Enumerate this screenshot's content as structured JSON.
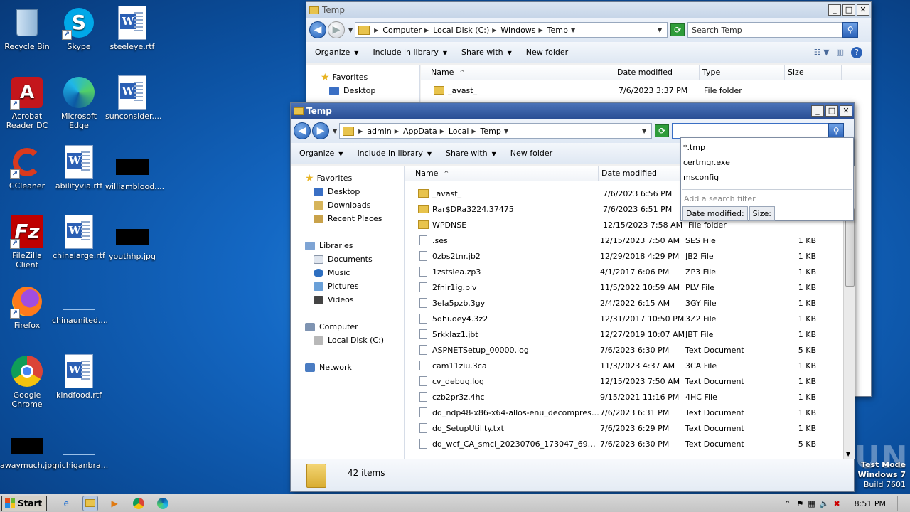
{
  "desktop": {
    "icons": [
      {
        "label": "Recycle Bin",
        "icon": "recycle-bin-icon"
      },
      {
        "label": "Skype",
        "icon": "skype-icon"
      },
      {
        "label": "steeleye.rtf",
        "icon": "word-doc-icon"
      },
      {
        "label": "Acrobat Reader DC",
        "icon": "acrobat-icon"
      },
      {
        "label": "Microsoft Edge",
        "icon": "edge-icon"
      },
      {
        "label": "sunconsider....",
        "icon": "word-doc-icon"
      },
      {
        "label": "CCleaner",
        "icon": "ccleaner-icon"
      },
      {
        "label": "abilityvia.rtf",
        "icon": "word-doc-icon"
      },
      {
        "label": "williamblood....",
        "icon": "image-thumb-icon"
      },
      {
        "label": "FileZilla Client",
        "icon": "filezilla-icon"
      },
      {
        "label": "chinalarge.rtf",
        "icon": "word-doc-icon"
      },
      {
        "label": "youthhp.jpg",
        "icon": "image-thumb-icon"
      },
      {
        "label": "Firefox",
        "icon": "firefox-icon"
      },
      {
        "label": "chinaunited....",
        "icon": "blank-file-icon"
      },
      {
        "label": "Google Chrome",
        "icon": "chrome-icon"
      },
      {
        "label": "kindfood.rtf",
        "icon": "word-doc-icon"
      },
      {
        "label": "awaymuch.jpg",
        "icon": "image-thumb-icon"
      },
      {
        "label": "michiganbra...",
        "icon": "blank-file-icon"
      }
    ]
  },
  "back_window": {
    "title": "Temp",
    "breadcrumbs": [
      "Computer",
      "Local Disk (C:)",
      "Windows",
      "Temp"
    ],
    "search_placeholder": "Search Temp",
    "toolbar": {
      "organize": "Organize",
      "include": "Include in library",
      "share": "Share with",
      "new_folder": "New folder"
    },
    "columns": {
      "name": "Name",
      "date": "Date modified",
      "type": "Type",
      "size": "Size"
    },
    "favorites": "Favorites",
    "desktop": "Desktop",
    "row": {
      "name": "_avast_",
      "date": "7/6/2023 3:37 PM",
      "type": "File folder"
    }
  },
  "front_window": {
    "title": "Temp",
    "breadcrumbs": [
      "admin",
      "AppData",
      "Local",
      "Temp"
    ],
    "search_value": "",
    "toolbar": {
      "organize": "Organize",
      "include": "Include in library",
      "share": "Share with",
      "new_folder": "New folder"
    },
    "columns": {
      "name": "Name",
      "date": "Date modified"
    },
    "nav": {
      "favorites": "Favorites",
      "desktop": "Desktop",
      "downloads": "Downloads",
      "recent": "Recent Places",
      "libraries": "Libraries",
      "documents": "Documents",
      "music": "Music",
      "pictures": "Pictures",
      "videos": "Videos",
      "computer": "Computer",
      "local_disk": "Local Disk (C:)",
      "network": "Network"
    },
    "search_suggestions": [
      "*.tmp",
      "certmgr.exe",
      "msconfig"
    ],
    "add_filter": "Add a search filter",
    "filters": [
      "Date modified:",
      "Size:"
    ],
    "files": [
      {
        "name": "_avast_",
        "date": "7/6/2023 6:56 PM",
        "type": "",
        "size": "",
        "kind": "folder"
      },
      {
        "name": "Rar$DRa3224.37475",
        "date": "7/6/2023 6:51 PM",
        "type": "",
        "size": "",
        "kind": "folder"
      },
      {
        "name": "WPDNSE",
        "date": "12/15/2023 7:58 AM",
        "type": "File folder",
        "size": "",
        "kind": "folder"
      },
      {
        "name": ".ses",
        "date": "12/15/2023 7:50 AM",
        "type": "SES File",
        "size": "1 KB",
        "kind": "file"
      },
      {
        "name": "0zbs2tnr.jb2",
        "date": "12/29/2018 4:29 PM",
        "type": "JB2 File",
        "size": "1 KB",
        "kind": "file"
      },
      {
        "name": "1zstsiea.zp3",
        "date": "4/1/2017 6:06 PM",
        "type": "ZP3 File",
        "size": "1 KB",
        "kind": "file"
      },
      {
        "name": "2fnir1ig.plv",
        "date": "11/5/2022 10:59 AM",
        "type": "PLV File",
        "size": "1 KB",
        "kind": "file"
      },
      {
        "name": "3ela5pzb.3gy",
        "date": "2/4/2022 6:15 AM",
        "type": "3GY File",
        "size": "1 KB",
        "kind": "file"
      },
      {
        "name": "5qhuoey4.3z2",
        "date": "12/31/2017 10:50 PM",
        "type": "3Z2 File",
        "size": "1 KB",
        "kind": "file"
      },
      {
        "name": "5rkklaz1.jbt",
        "date": "12/27/2019 10:07 AM",
        "type": "JBT File",
        "size": "1 KB",
        "kind": "file"
      },
      {
        "name": "ASPNETSetup_00000.log",
        "date": "7/6/2023 6:30 PM",
        "type": "Text Document",
        "size": "5 KB",
        "kind": "file"
      },
      {
        "name": "cam11ziu.3ca",
        "date": "11/3/2023 4:37 AM",
        "type": "3CA File",
        "size": "1 KB",
        "kind": "file"
      },
      {
        "name": "cv_debug.log",
        "date": "12/15/2023 7:50 AM",
        "type": "Text Document",
        "size": "1 KB",
        "kind": "file"
      },
      {
        "name": "czb2pr3z.4hc",
        "date": "9/15/2021 11:16 PM",
        "type": "4HC File",
        "size": "1 KB",
        "kind": "file"
      },
      {
        "name": "dd_ndp48-x86-x64-allos-enu_decompression...",
        "date": "7/6/2023 6:31 PM",
        "type": "Text Document",
        "size": "1 KB",
        "kind": "file"
      },
      {
        "name": "dd_SetupUtility.txt",
        "date": "7/6/2023 6:29 PM",
        "type": "Text Document",
        "size": "1 KB",
        "kind": "file"
      },
      {
        "name": "dd_wcf_CA_smci_20230706_173047_693.txt",
        "date": "7/6/2023 6:30 PM",
        "type": "Text Document",
        "size": "5 KB",
        "kind": "file"
      }
    ],
    "status": "42 items"
  },
  "taskbar": {
    "start": "Start",
    "time": "8:51 PM"
  },
  "watermark": {
    "line1": "Test Mode",
    "line2": "Windows 7",
    "line3": "Build 7601",
    "brand": "ANY RUN"
  }
}
